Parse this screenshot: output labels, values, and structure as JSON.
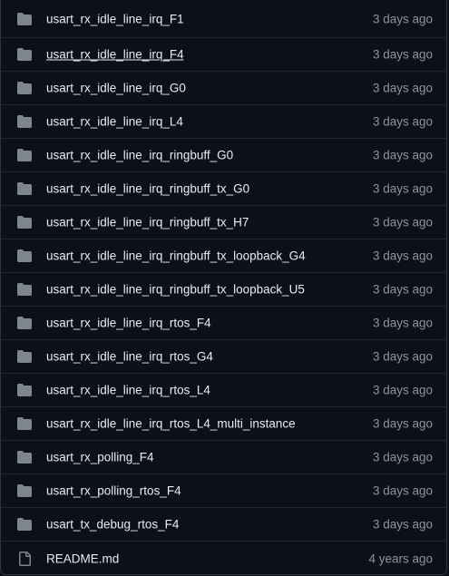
{
  "colors": {
    "background": "#0d1117",
    "border": "#30363d",
    "row_divider": "#21262d",
    "folder_icon": "#7d8590",
    "text": "#e6edf3",
    "muted": "#8b949e"
  },
  "rows": [
    {
      "type": "folder",
      "icon": "folder-icon",
      "name": "usart_rx_idle_line_irq_F1",
      "age": "3 days ago"
    },
    {
      "type": "folder",
      "icon": "folder-icon",
      "name": "usart_rx_idle_line_irq_F4",
      "age": "3 days ago",
      "hovered": true
    },
    {
      "type": "folder",
      "icon": "folder-icon",
      "name": "usart_rx_idle_line_irq_G0",
      "age": "3 days ago"
    },
    {
      "type": "folder",
      "icon": "folder-icon",
      "name": "usart_rx_idle_line_irq_L4",
      "age": "3 days ago"
    },
    {
      "type": "folder",
      "icon": "folder-icon",
      "name": "usart_rx_idle_line_irq_ringbuff_G0",
      "age": "3 days ago"
    },
    {
      "type": "folder",
      "icon": "folder-icon",
      "name": "usart_rx_idle_line_irq_ringbuff_tx_G0",
      "age": "3 days ago"
    },
    {
      "type": "folder",
      "icon": "folder-icon",
      "name": "usart_rx_idle_line_irq_ringbuff_tx_H7",
      "age": "3 days ago"
    },
    {
      "type": "folder",
      "icon": "folder-icon",
      "name": "usart_rx_idle_line_irq_ringbuff_tx_loopback_G4",
      "age": "3 days ago"
    },
    {
      "type": "folder",
      "icon": "folder-icon",
      "name": "usart_rx_idle_line_irq_ringbuff_tx_loopback_U5",
      "age": "3 days ago"
    },
    {
      "type": "folder",
      "icon": "folder-icon",
      "name": "usart_rx_idle_line_irq_rtos_F4",
      "age": "3 days ago"
    },
    {
      "type": "folder",
      "icon": "folder-icon",
      "name": "usart_rx_idle_line_irq_rtos_G4",
      "age": "3 days ago"
    },
    {
      "type": "folder",
      "icon": "folder-icon",
      "name": "usart_rx_idle_line_irq_rtos_L4",
      "age": "3 days ago"
    },
    {
      "type": "folder",
      "icon": "folder-icon",
      "name": "usart_rx_idle_line_irq_rtos_L4_multi_instance",
      "age": "3 days ago"
    },
    {
      "type": "folder",
      "icon": "folder-icon",
      "name": "usart_rx_polling_F4",
      "age": "3 days ago"
    },
    {
      "type": "folder",
      "icon": "folder-icon",
      "name": "usart_rx_polling_rtos_F4",
      "age": "3 days ago"
    },
    {
      "type": "folder",
      "icon": "folder-icon",
      "name": "usart_tx_debug_rtos_F4",
      "age": "3 days ago"
    },
    {
      "type": "file",
      "icon": "file-icon",
      "name": "README.md",
      "age": "4 years ago"
    }
  ]
}
